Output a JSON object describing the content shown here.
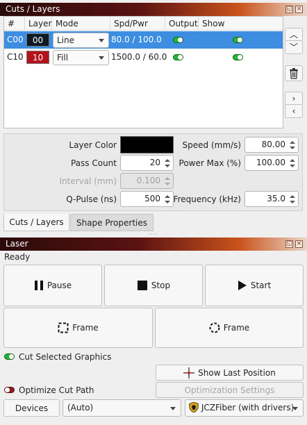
{
  "cuts_panel": {
    "title": "Cuts / Layers",
    "columns": [
      "#",
      "Layer",
      "Mode",
      "Spd/Pwr",
      "Output",
      "Show"
    ],
    "rows": [
      {
        "id": "C00",
        "layer": "00",
        "layer_color": "#0d1a26",
        "mode": "Line",
        "spd_pwr": "80.0 / 100.0",
        "output": true,
        "show": true,
        "selected": true
      },
      {
        "id": "C10",
        "layer": "10",
        "layer_color": "#b3121b",
        "mode": "Fill",
        "spd_pwr": "1500.0 / 60.0",
        "output": true,
        "show": true,
        "selected": false
      }
    ],
    "side_buttons": [
      "▲",
      "▼",
      "trash-icon",
      "▶",
      "◀"
    ]
  },
  "properties": {
    "layer_color_label": "Layer Color",
    "pass_count_label": "Pass Count",
    "pass_count_value": "20",
    "interval_label": "Interval (mm)",
    "interval_value": "0.100",
    "qpulse_label": "Q-Pulse (ns)",
    "qpulse_value": "500",
    "speed_label": "Speed (mm/s)",
    "speed_value": "80.00",
    "power_label": "Power Max (%)",
    "power_value": "100.00",
    "frequency_label": "Frequency (kHz)",
    "frequency_value": "35.0"
  },
  "tabs": {
    "cuts_layers": "Cuts / Layers",
    "shape_properties": "Shape Properties"
  },
  "laser_panel": {
    "title": "Laser",
    "status": "Ready",
    "pause": "Pause",
    "stop": "Stop",
    "start": "Start",
    "frame_rect": "Frame",
    "frame_circle": "Frame",
    "cut_selected": "Cut Selected Graphics",
    "cut_selected_on": true,
    "show_last_position": "Show Last Position",
    "optimize_cut_path": "Optimize Cut Path",
    "optimize_on": false,
    "optimization_settings": "Optimization Settings",
    "devices": "Devices",
    "position_mode": "(Auto)",
    "device_name": "JCZFiber (with drivers)"
  }
}
